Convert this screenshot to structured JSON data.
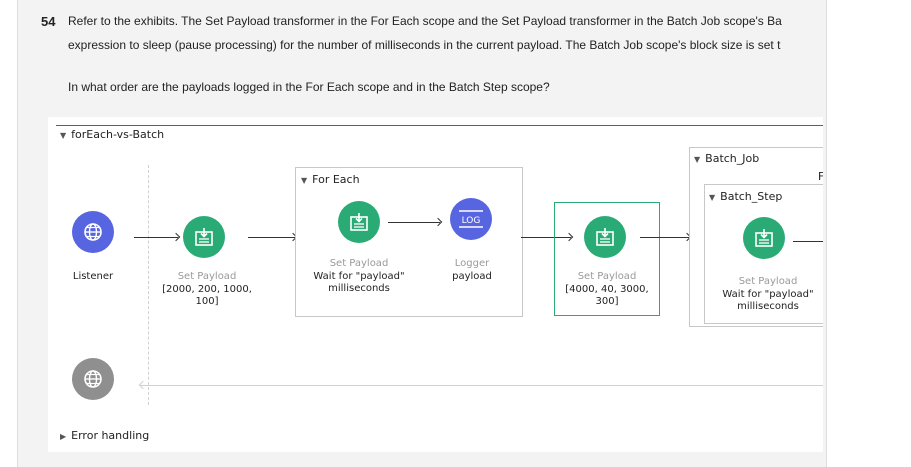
{
  "question": {
    "number": "54",
    "line1": "Refer to the exhibits. The Set Payload transformer in the For Each scope and the Set Payload transformer in the Batch Job scope's Ba",
    "line2": "expression to sleep (pause processing) for the number of milliseconds in the current payload. The Batch Job scope's block size is set t",
    "prompt": "In what order are the payloads logged in the For Each scope and in the Batch Step scope?"
  },
  "diagram": {
    "flow_name": "forEach-vs-Batch",
    "listener": {
      "label": "Listener"
    },
    "set_payload_1": {
      "title": "Set Payload",
      "value_line1": "[2000, 200, 1000,",
      "value_line2": "100]"
    },
    "for_each": {
      "title": "For Each",
      "set_payload": {
        "title": "Set Payload",
        "line1": "Wait for \"payload\"",
        "line2": "milliseconds"
      },
      "logger": {
        "title": "Logger",
        "value": "payload",
        "icon_text": "LOG"
      }
    },
    "set_payload_2": {
      "title": "Set Payload",
      "value_line1": "[4000, 40, 3000,",
      "value_line2": "300]"
    },
    "batch_job": {
      "title": "Batch_Job",
      "clipped_char": "F",
      "batch_step": {
        "title": "Batch_Step",
        "set_payload": {
          "title": "Set Payload",
          "line1": "Wait for \"payload\"",
          "line2": "milliseconds"
        }
      }
    },
    "error_handling": "Error handling"
  },
  "colors": {
    "accent_green": "#2aab75",
    "logger_blue": "#5865e0",
    "flow_blue": "#0a77c2",
    "error_gray": "#8f8f8f"
  },
  "icons": [
    "globe-icon",
    "set-payload-icon",
    "logger-icon",
    "error-globe-icon",
    "triangle-down-icon",
    "triangle-right-icon"
  ]
}
